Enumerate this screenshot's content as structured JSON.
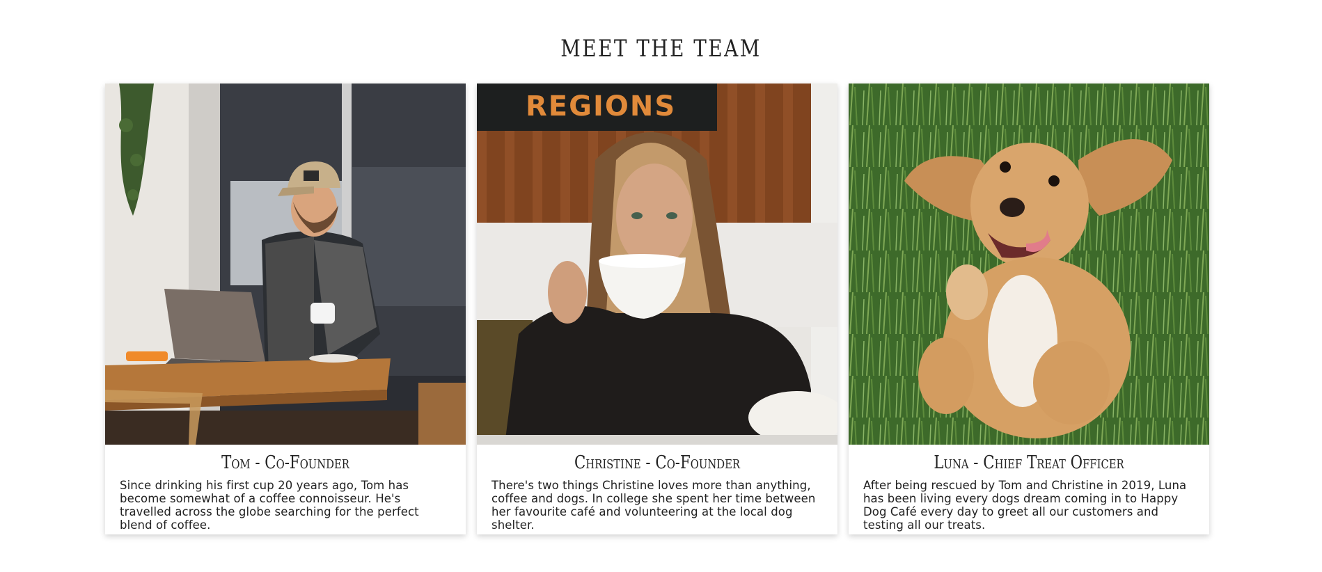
{
  "section": {
    "title": "MEET THE TEAM"
  },
  "team": [
    {
      "name": "Tom - Co-Founder",
      "bio": "Since drinking his first cup 20 years ago, Tom has become somewhat of a coffee connoisseur. He's travelled across the globe searching for the perfect blend of coffee.",
      "photo": "man-in-cap-drinking-coffee-at-laptop"
    },
    {
      "name": "Christine - Co-Founder",
      "bio": "There's two things Christine loves more than anything, coffee and dogs. In college she spent her time between her favourite café and volunteering at the local dog shelter.",
      "photo": "woman-sipping-from-white-cup"
    },
    {
      "name": "Luna - Chief Treat Officer",
      "bio": "After being rescued by Tom and Christine in 2019, Luna has been living every dogs dream coming in to Happy Dog Café every day to greet all our customers and testing all our treats.",
      "photo": "golden-puppy-lying-in-grass"
    }
  ],
  "photo_sign_text": "REGIONS"
}
